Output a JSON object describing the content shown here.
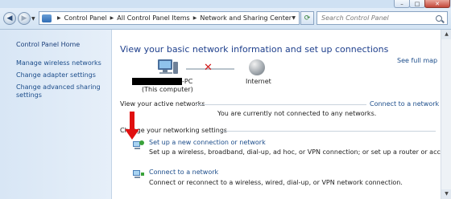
{
  "window": {
    "controls": {
      "minimize": "–",
      "maximize": "□",
      "close": "✕"
    }
  },
  "address_bar": {
    "crumbs": [
      "Control Panel",
      "All Control Panel Items",
      "Network and Sharing Center"
    ],
    "search_placeholder": "Search Control Panel"
  },
  "sidebar": {
    "home": "Control Panel Home",
    "items": [
      {
        "label": "Manage wireless networks"
      },
      {
        "label": "Change adapter settings"
      },
      {
        "label": "Change advanced sharing settings"
      }
    ]
  },
  "main": {
    "heading": "View your basic network information and set up connections",
    "see_full_map": "See full map",
    "computer": {
      "name_suffix": "-PC",
      "sub": "(This computer)"
    },
    "internet": "Internet",
    "active_networks_label": "View your active networks",
    "active_status": "You are currently not connected to any networks.",
    "connect_link": "Connect to a network",
    "change_settings_label": "Change your networking settings",
    "tasks": [
      {
        "title": "Set up a new connection or network",
        "desc": "Set up a wireless, broadband, dial-up, ad hoc, or VPN connection; or set up a router or access point."
      },
      {
        "title": "Connect to a network",
        "desc": "Connect or reconnect to a wireless, wired, dial-up, or VPN network connection."
      }
    ]
  },
  "colors": {
    "link": "#1b4c8a",
    "heading": "#1e3f8c",
    "error": "#d21c1c",
    "pointer_arrow": "#e01010"
  }
}
